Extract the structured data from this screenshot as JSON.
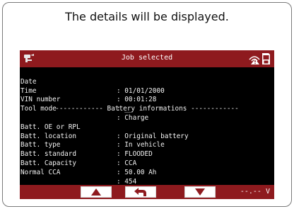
{
  "caption": "The details will be displayed.",
  "screen": {
    "title": "Job selected",
    "icons": {
      "tool": "clamp-tool-icon",
      "wireless": "wireless-alert-icon",
      "device": "sd-card-icon"
    },
    "rows_top": [
      {
        "label": "Date",
        "value": ": 01/01/2000"
      },
      {
        "label": "Time",
        "value": ": 00:01:28"
      },
      {
        "label": "VIN number",
        "value": ": __"
      },
      {
        "label": "Tool mode",
        "value": ": Charge"
      }
    ],
    "section_header": "------------ Battery informations ------------",
    "rows_battery": [
      {
        "label": "Batt. OE or RPL",
        "value": ": Original battery"
      },
      {
        "label": "Batt. location",
        "value": ": In vehicle"
      },
      {
        "label": "Batt. type",
        "value": ": FLOODED"
      },
      {
        "label": "Batt. standard",
        "value": ": CCA"
      },
      {
        "label": "Batt. Capacity",
        "value": ": 50.00 Ah"
      },
      {
        "label": "Normal CCA",
        "value": ": 454"
      }
    ],
    "bottom": {
      "up_icon": "arrow-up-icon",
      "back_icon": "back-arrow-icon",
      "down_icon": "arrow-down-icon",
      "voltage": "--.-- V"
    }
  },
  "colors": {
    "bar": "#8e1a1e",
    "screen_bg": "#000000",
    "text": "#f2f2f2"
  }
}
